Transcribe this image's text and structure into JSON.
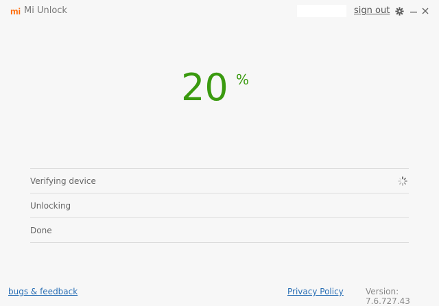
{
  "titlebar": {
    "logo_text": "mi",
    "app_title": "Mi Unlock",
    "signout_label": "sign out",
    "icons": [
      "gear-icon",
      "minimize-icon",
      "close-icon"
    ]
  },
  "progress": {
    "value": "20",
    "unit": "%",
    "fraction": 0.2,
    "color": "#3a9a0f"
  },
  "steps": [
    {
      "label": "Verifying device",
      "status": "in-progress"
    },
    {
      "label": "Unlocking",
      "status": "pending"
    },
    {
      "label": "Done",
      "status": "pending"
    }
  ],
  "footer": {
    "bugs_label": "bugs & feedback",
    "privacy_label": "Privacy Policy",
    "version": "Version: 7.6.727.43"
  },
  "colors": {
    "brand": "#ff6700",
    "accent": "#3a9a0f",
    "link": "#2a6fb5"
  }
}
